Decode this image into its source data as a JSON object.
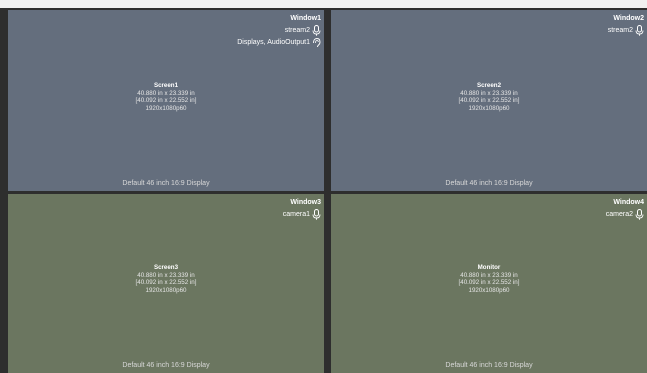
{
  "colors": {
    "pane_blue": "#646e7d",
    "pane_green": "#6b7660",
    "frame": "#2e2e2e",
    "text": "#ffffff"
  },
  "windows": [
    {
      "title": "Window1",
      "sources": [
        {
          "label": "stream2",
          "icon": "microphone-icon"
        },
        {
          "label": "Displays, AudioOutput1",
          "icon": "audio-output-icon"
        }
      ],
      "screen_name": "Screen1",
      "size_line": "40.880 in x 23.339 in",
      "inner_size_line": "[40.092 in x 22.552 in]",
      "resolution": "1920x1080p60",
      "footer": "Default 46 inch 16:9 Display"
    },
    {
      "title": "Window2",
      "sources": [
        {
          "label": "stream2",
          "icon": "microphone-icon"
        }
      ],
      "screen_name": "Screen2",
      "size_line": "40.880 in x 23.339 in",
      "inner_size_line": "[40.092 in x 22.552 in]",
      "resolution": "1920x1080p60",
      "footer": "Default 46 inch 16:9 Display"
    },
    {
      "title": "Window3",
      "sources": [
        {
          "label": "camera1",
          "icon": "microphone-icon"
        }
      ],
      "screen_name": "Screen3",
      "size_line": "40.880 in x 23.339 in",
      "inner_size_line": "[40.092 in x 22.552 in]",
      "resolution": "1920x1080p60",
      "footer": "Default 46 inch 16:9 Display"
    },
    {
      "title": "Window4",
      "sources": [
        {
          "label": "camera2",
          "icon": "microphone-icon"
        }
      ],
      "screen_name": "Monitor",
      "size_line": "40.880 in x 23.339 in",
      "inner_size_line": "[40.092 in x 22.552 in]",
      "resolution": "1920x1080p60",
      "footer": "Default 46 inch 16:9 Display"
    }
  ]
}
